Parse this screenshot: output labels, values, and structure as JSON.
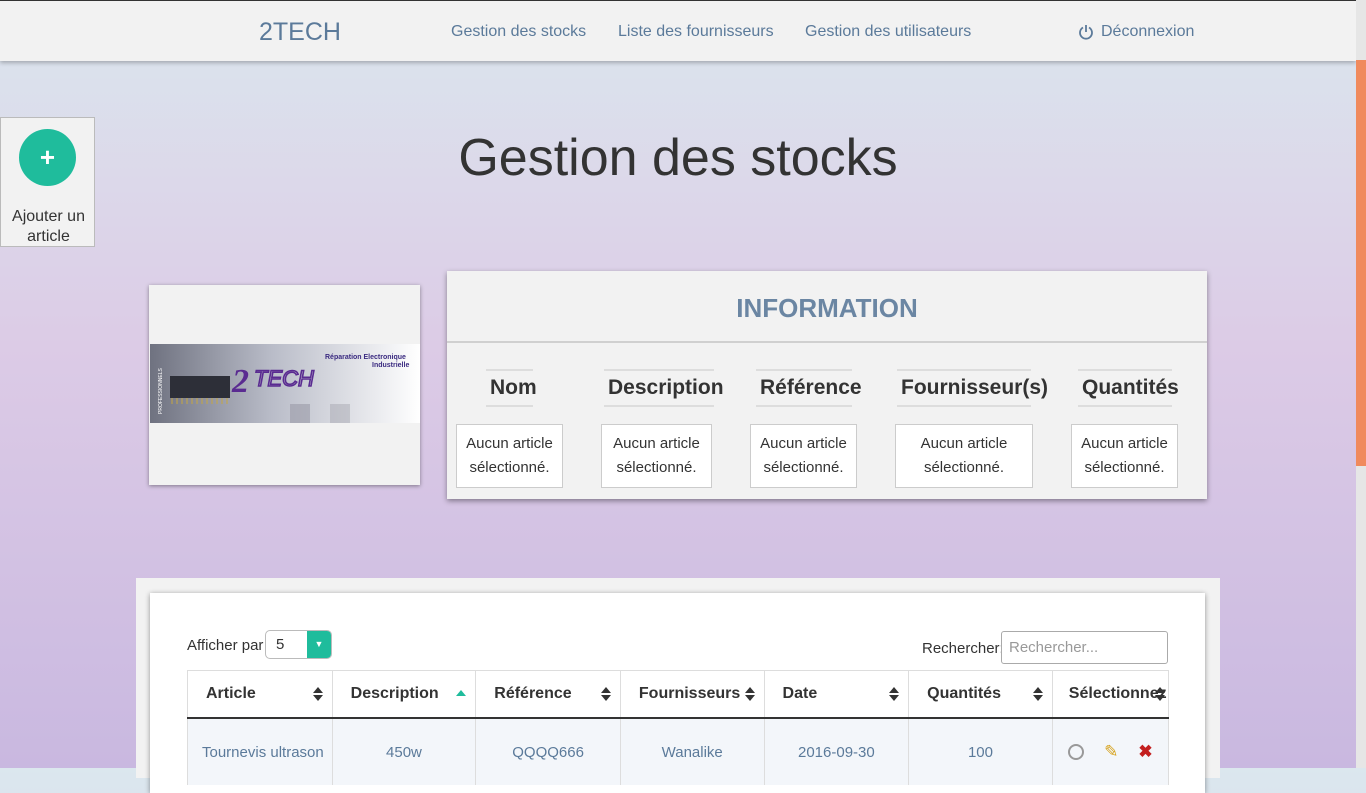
{
  "navbar": {
    "brand": "2TECH",
    "links": [
      "Gestion des stocks",
      "Liste des fournisseurs",
      "Gestion des utilisateurs"
    ],
    "logout": "Déconnexion",
    "logout_icon": "power-icon"
  },
  "add_article": {
    "icon": "plus-icon",
    "label": "Ajouter un article"
  },
  "page_title": "Gestion des stocks",
  "logo": {
    "brand": "2TECH",
    "tagline_1": "Réparation Electronique",
    "tagline_2": "Industrielle",
    "side_text": "PROFESSIONNELS"
  },
  "information": {
    "title": "INFORMATION",
    "columns": [
      {
        "label": "Nom",
        "value": "Aucun article sélectionné."
      },
      {
        "label": "Description",
        "value": "Aucun article sélectionné."
      },
      {
        "label": "Référence",
        "value": "Aucun article sélectionné."
      },
      {
        "label": "Fournisseur(s)",
        "value": "Aucun article sélectionné."
      },
      {
        "label": "Quantités",
        "value": "Aucun article sélectionné."
      }
    ]
  },
  "table": {
    "show_label": "Afficher par",
    "per_page": "5",
    "search_label": "Rechercher:",
    "search_placeholder": "Rechercher...",
    "headers": [
      "Article",
      "Description",
      "Référence",
      "Fournisseurs",
      "Date",
      "Quantités",
      "Sélectionnez"
    ],
    "sorted_column": "Description",
    "rows": [
      {
        "article": "Tournevis ultrason",
        "description": "450w",
        "reference": "QQQQ666",
        "fournisseurs": "Wanalike",
        "date": "2016-09-30",
        "quantites": "100"
      }
    ]
  },
  "colors": {
    "accent": "#1fbc9c",
    "nav_text": "#5b7a9a",
    "scroll_thumb": "#f08a5d",
    "delete": "#c31f1f"
  }
}
